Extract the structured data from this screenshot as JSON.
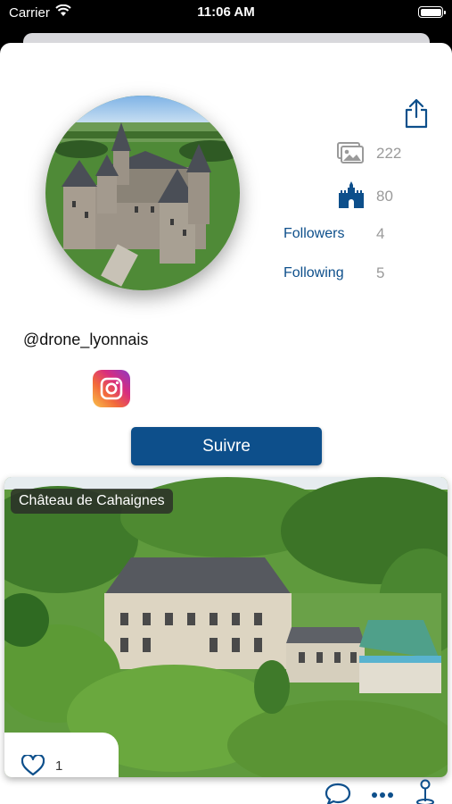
{
  "status_bar": {
    "carrier": "Carrier",
    "time": "11:06 AM"
  },
  "profile": {
    "username": "@drone_lyonnais",
    "photos_count": "222",
    "castles_count": "80",
    "followers_label": "Followers",
    "followers_count": "4",
    "following_label": "Following",
    "following_count": "5",
    "follow_button_label": "Suivre"
  },
  "post": {
    "title": "Château de Cahaignes",
    "likes_count": "1"
  },
  "colors": {
    "accent": "#0d4f8b",
    "muted": "#9a9a9a"
  }
}
